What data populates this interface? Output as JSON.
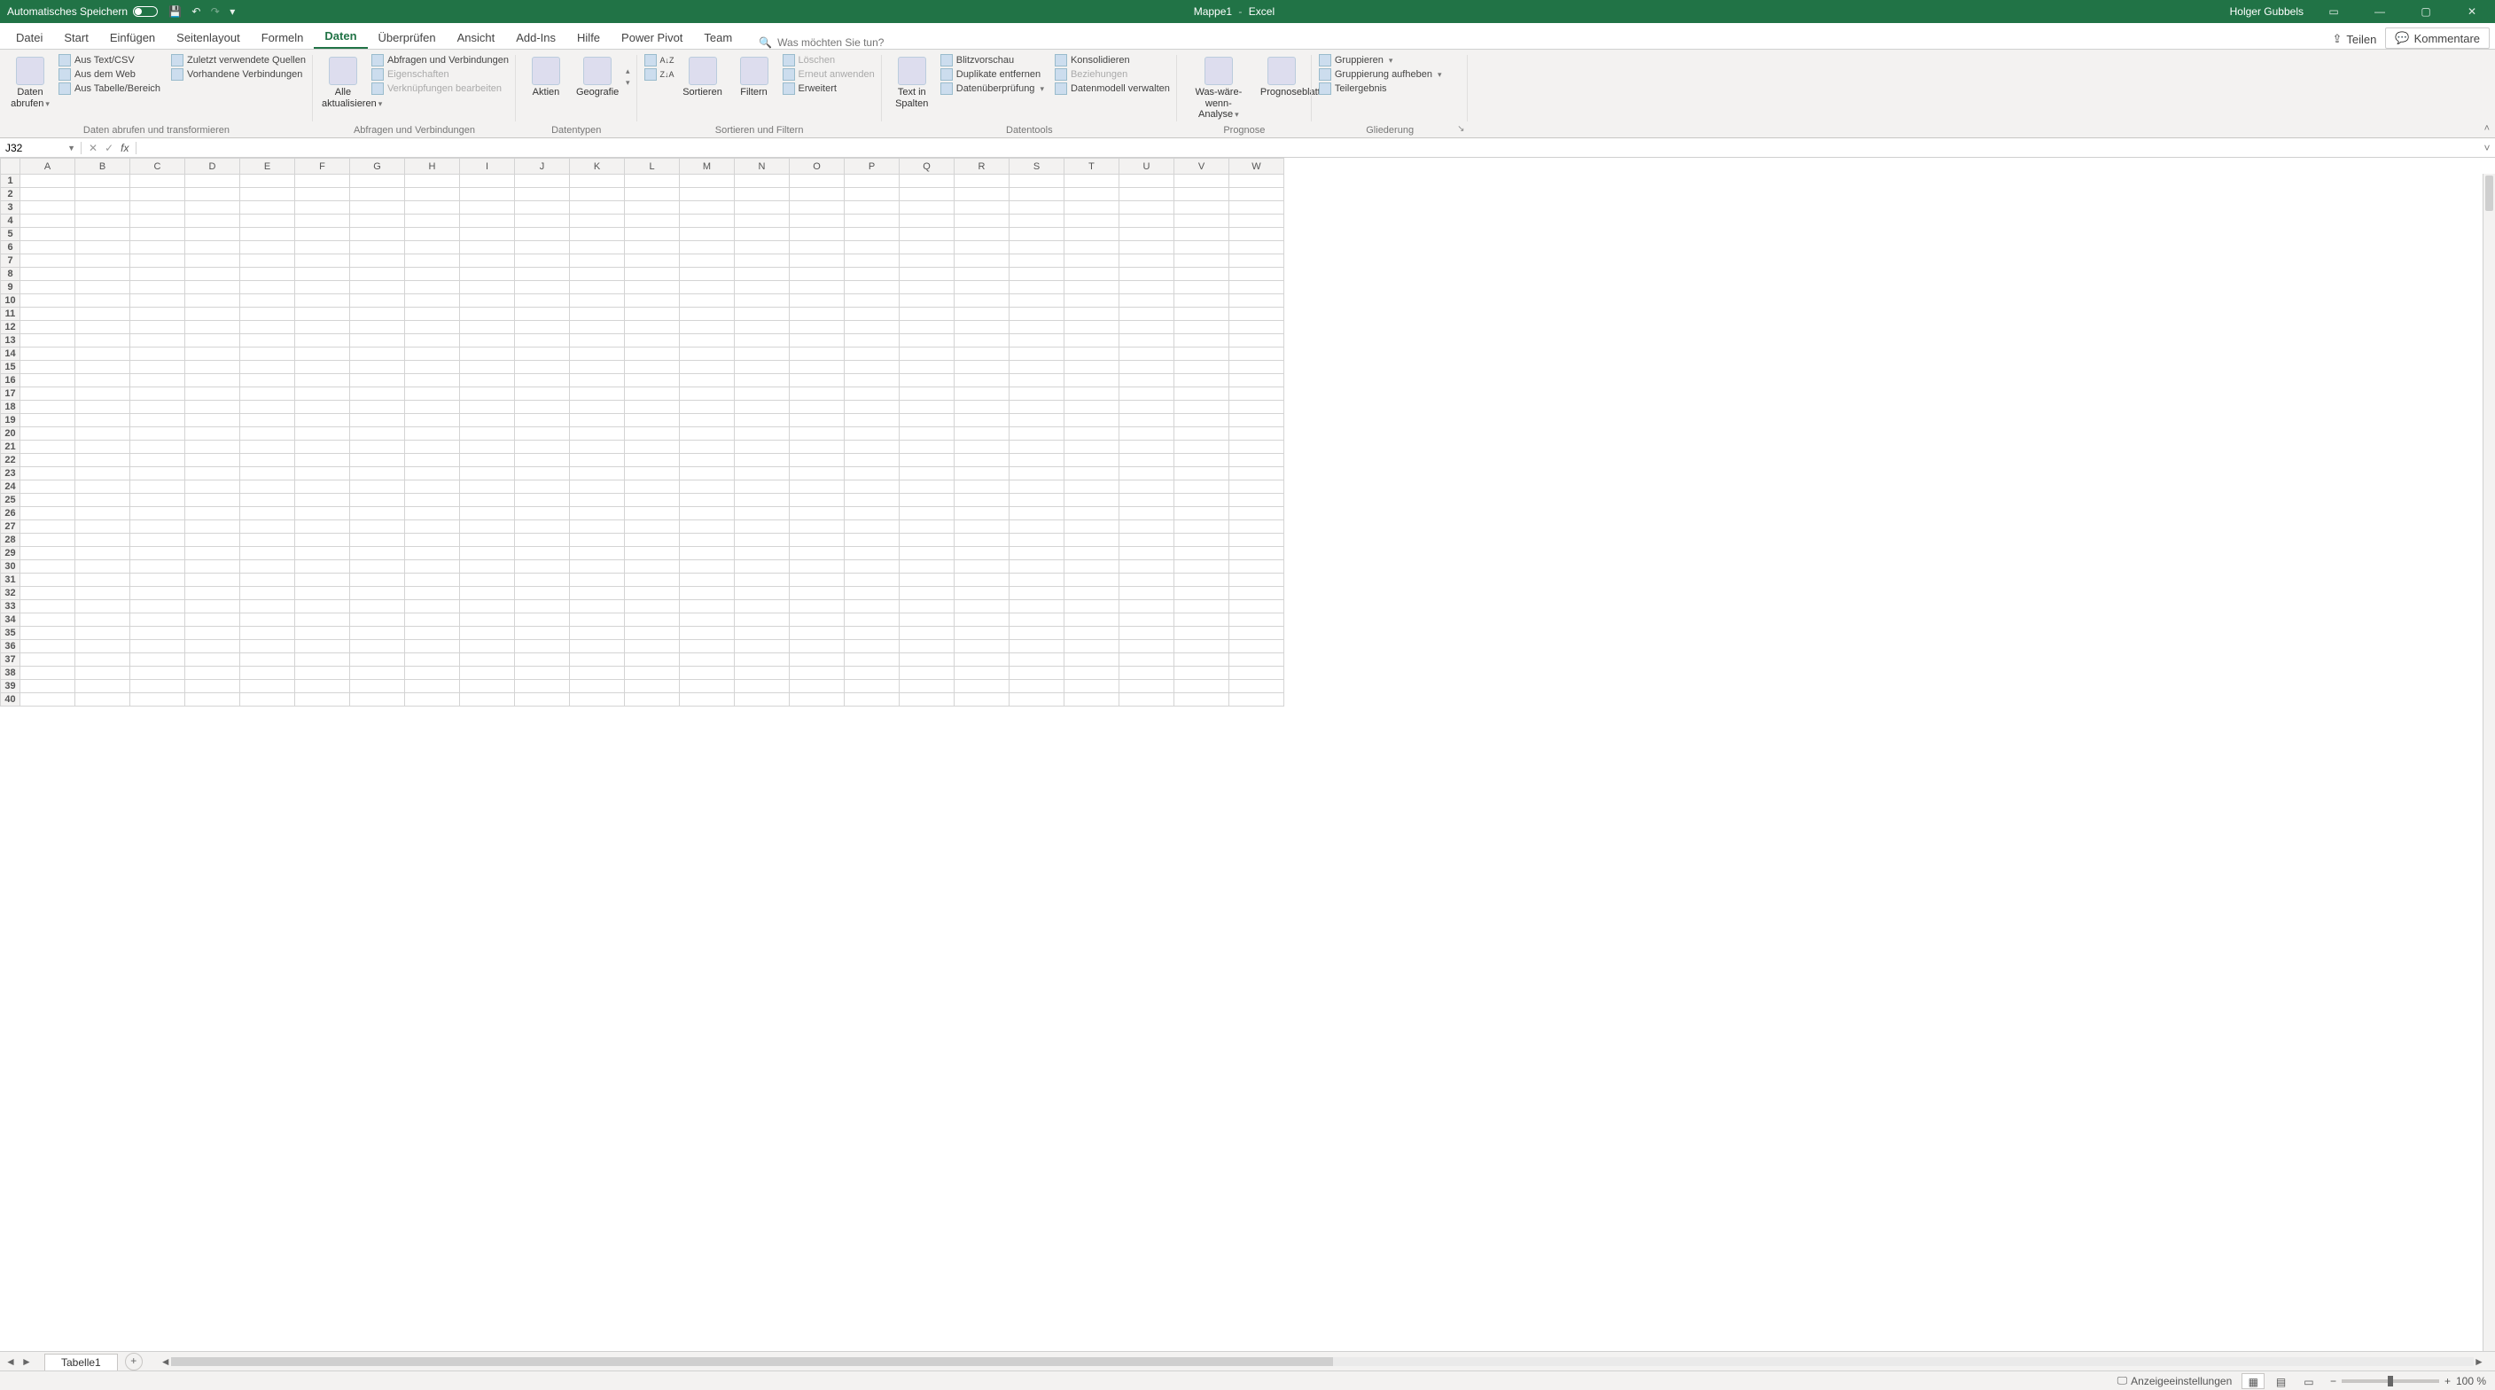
{
  "title": {
    "doc": "Mappe1",
    "sep": "-",
    "app": "Excel"
  },
  "user": "Holger Gubbels",
  "autosave_label": "Automatisches Speichern",
  "quick_access": {
    "save": "💾",
    "undo": "↶",
    "redo": "↷",
    "more": "▾"
  },
  "window_buttons": {
    "ribbonmode": "▭",
    "min": "—",
    "max": "▢",
    "close": "✕"
  },
  "tabs": [
    "Datei",
    "Start",
    "Einfügen",
    "Seitenlayout",
    "Formeln",
    "Daten",
    "Überprüfen",
    "Ansicht",
    "Add-Ins",
    "Hilfe",
    "Power Pivot",
    "Team"
  ],
  "active_tab_index": 5,
  "tellme": {
    "icon": "🔍",
    "placeholder": "Was möchten Sie tun?"
  },
  "share": {
    "icon": "⇪",
    "label": "Teilen"
  },
  "comments": {
    "icon": "💬",
    "label": "Kommentare"
  },
  "ribbon": {
    "get_transform": {
      "title": "Daten abrufen und transformieren",
      "big": "Daten abrufen",
      "items": [
        "Aus Text/CSV",
        "Aus dem Web",
        "Aus Tabelle/Bereich",
        "Zuletzt verwendete Quellen",
        "Vorhandene Verbindungen"
      ]
    },
    "queries": {
      "title": "Abfragen und Verbindungen",
      "big": "Alle aktualisieren",
      "items": [
        {
          "label": "Abfragen und Verbindungen",
          "disabled": false
        },
        {
          "label": "Eigenschaften",
          "disabled": true
        },
        {
          "label": "Verknüpfungen bearbeiten",
          "disabled": true
        }
      ]
    },
    "datatypes": {
      "title": "Datentypen",
      "items": [
        "Aktien",
        "Geografie"
      ]
    },
    "sort_filter": {
      "title": "Sortieren und Filtern",
      "sort_small": "A↓Z",
      "sort_small2": "Z↓A",
      "sort": "Sortieren",
      "filter": "Filtern",
      "clear": {
        "label": "Löschen",
        "disabled": true
      },
      "reapply": {
        "label": "Erneut anwenden",
        "disabled": true
      },
      "advanced": "Erweitert"
    },
    "datatools": {
      "title": "Datentools",
      "col1": "Text in Spalten",
      "items": [
        "Blitzvorschau",
        "Duplikate entfernen",
        "Datenüberprüfung"
      ],
      "items2": [
        {
          "label": "Konsolidieren",
          "disabled": false
        },
        {
          "label": "Beziehungen",
          "disabled": true
        },
        {
          "label": "Datenmodell verwalten",
          "disabled": false
        }
      ]
    },
    "forecast": {
      "title": "Prognose",
      "whatif": "Was-wäre-wenn-Analyse",
      "sheet": "Prognoseblatt"
    },
    "outline": {
      "title": "Gliederung",
      "group": "Gruppieren",
      "ungroup": "Gruppierung aufheben",
      "subtotal": "Teilergebnis"
    }
  },
  "namebox": "J32",
  "formula": "",
  "fx_controls": {
    "cancel": "✕",
    "enter": "✓",
    "fx": "fx"
  },
  "columns": [
    "A",
    "B",
    "C",
    "D",
    "E",
    "F",
    "G",
    "H",
    "I",
    "J",
    "K",
    "L",
    "M",
    "N",
    "O",
    "P",
    "Q",
    "R",
    "S",
    "T",
    "U",
    "V",
    "W"
  ],
  "rows": 40,
  "sheet_tab": "Tabelle1",
  "sheet_nav": {
    "first": "◄",
    "last": "►"
  },
  "status": {
    "display_settings": "Anzeigeeinstellungen",
    "view_normal": "▦",
    "view_layout": "▤",
    "view_break": "▭",
    "zoom_out": "−",
    "zoom_in": "+",
    "zoom": "100 %"
  }
}
